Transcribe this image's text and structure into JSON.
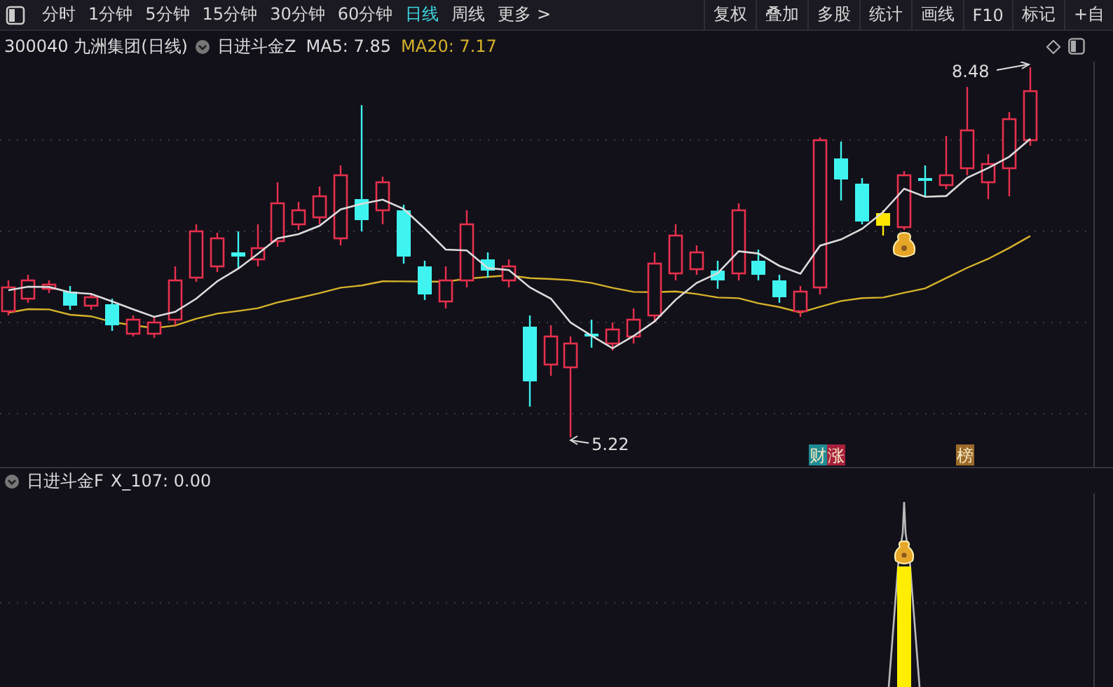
{
  "toolbar": {
    "periods": [
      {
        "label": "分时",
        "selected": false
      },
      {
        "label": "1分钟",
        "selected": false
      },
      {
        "label": "5分钟",
        "selected": false
      },
      {
        "label": "15分钟",
        "selected": false
      },
      {
        "label": "30分钟",
        "selected": false
      },
      {
        "label": "60分钟",
        "selected": false
      },
      {
        "label": "日线",
        "selected": true
      },
      {
        "label": "周线",
        "selected": false
      }
    ],
    "more": "更多 >",
    "actions": [
      "复权",
      "叠加",
      "多股",
      "统计",
      "画线",
      "F10",
      "标记",
      "+自"
    ]
  },
  "main_panel": {
    "title": "300040 九洲集团(日线)",
    "indicator": "日进斗金Z",
    "ma": [
      {
        "label": "MA5: 7.85",
        "color": "#dcdcdc"
      },
      {
        "label": "MA20: 7.17",
        "color": "#d6b22a"
      }
    ],
    "high_label": "8.48",
    "low_label": "5.22",
    "markers": [
      {
        "text": "财",
        "color": "#1f8c94"
      },
      {
        "text": "涨",
        "color": "#a8203c"
      },
      {
        "text": "榜",
        "color": "#9c6a28"
      }
    ]
  },
  "sub_panel": {
    "indicator": "日进斗金F",
    "reading": "X_107: 0.00"
  }
}
